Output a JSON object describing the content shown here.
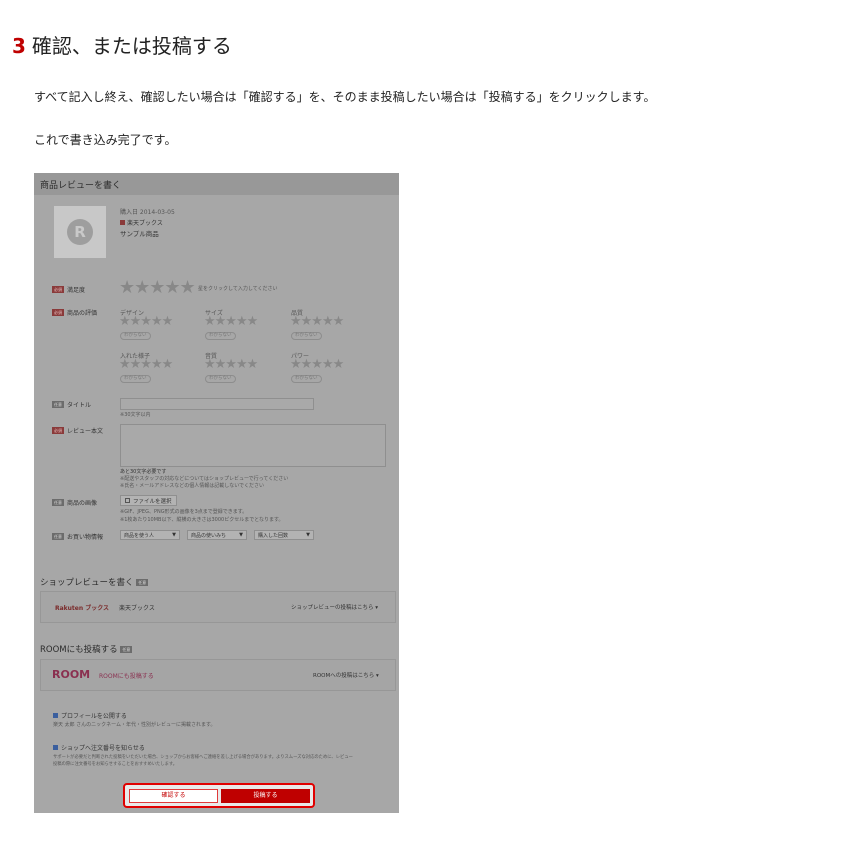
{
  "heading": {
    "number": "3",
    "title": "確認、または投稿する"
  },
  "paragraphs": [
    "すべて記入し終え、確認したい場合は「確認する」を、そのまま投稿したい場合は「投稿する」をクリックします。",
    "これで書き込み完了です。"
  ],
  "screenshot": {
    "header": "商品レビューを書く",
    "purchase_date": "購入日 2014-03-05",
    "shop_name": "楽天ブックス",
    "product_name": "サンプル商品",
    "thumb_letter": "R",
    "required_badge": "必須",
    "optional_badge": "任意",
    "satisfaction_label": "満足度",
    "satisfaction_hint": "星をクリックして入力してください",
    "evaluation_label": "商品の評価",
    "criteria": [
      {
        "label": "デザイン"
      },
      {
        "label": "サイズ"
      },
      {
        "label": "品質"
      },
      {
        "label": "入れた様子"
      },
      {
        "label": "音質"
      },
      {
        "label": "パワー"
      }
    ],
    "unknown_pill": "わからない",
    "title_label": "タイトル",
    "title_note": "※30文字以内",
    "review_label": "レビュー本文",
    "review_notes": [
      "あと30文字必要です",
      "※配送やスタッフの対応などについてはショップレビューで行ってください",
      "※氏名・メールアドレスなどの個人情報は記載しないでください"
    ],
    "image_label": "商品の画像",
    "file_button": "ファイルを選択",
    "image_notes": [
      "※GIF、JPEG、PNG形式の画像を3点まで登録できます。",
      "※1枚あたり10MB以下、縦横の大きさは3000ピクセルまでとなります。"
    ],
    "purchase_info_label": "お買い物情報",
    "selects": [
      "商品を使う人",
      "商品の使いみち",
      "購入した回数"
    ],
    "shop_review_heading": "ショップレビューを書く",
    "shop_logo": "Rakuten ブックス",
    "shop_card_name": "楽天ブックス",
    "shop_card_link": "ショップレビューの投稿はこちら",
    "room_heading": "ROOMにも投稿する",
    "room_logo": "ROOM",
    "room_card_text": "ROOMにも投稿する",
    "room_card_link": "ROOMへの投稿はこちら",
    "profile_check": "プロフィールを公開する",
    "profile_note": "楽天 太郎  さんのニックネーム・年代・性別がレビューに掲載されます。",
    "order_check": "ショップへ注文番号を知らせる",
    "order_note_1": "サポートが必要だと判断された投稿をいただいた場合、ショップからお客様へご連絡を差し上げる場合があります。よりスムーズな対応のために、レビュー",
    "order_note_2": "投稿の際に注文番号をお知らせすることをおすすめいたします。",
    "confirm_button": "確認する",
    "post_button": "投稿する"
  },
  "colors": {
    "accent_red": "#bf0000",
    "room_pink": "#b0305a",
    "overlay_gray": "#a7a7a7"
  }
}
